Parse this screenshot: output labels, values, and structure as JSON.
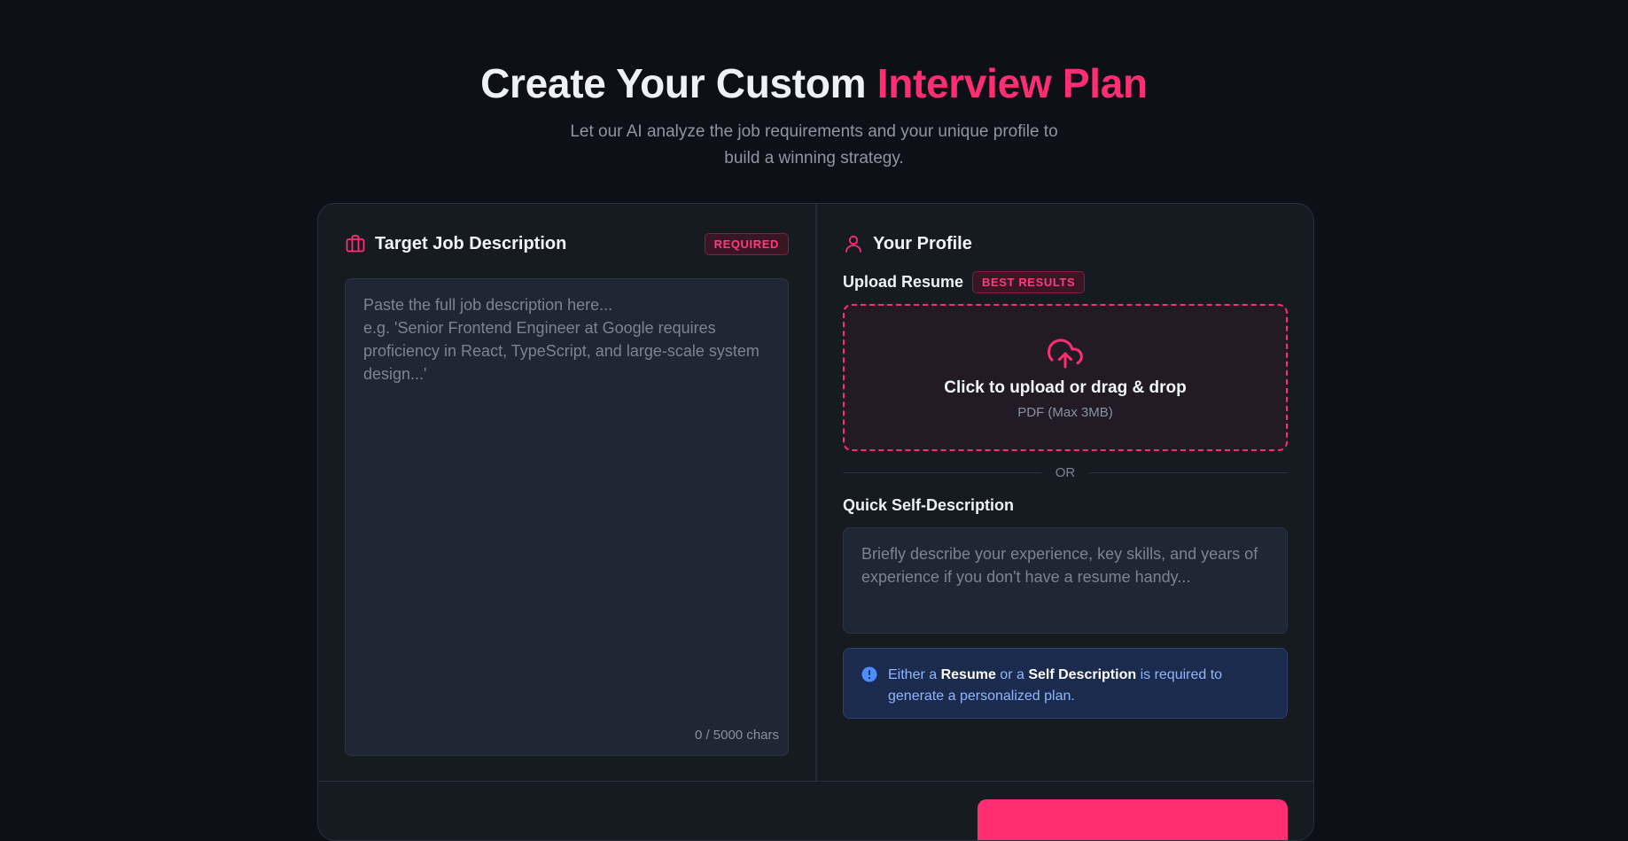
{
  "hero": {
    "title_main": "Create Your Custom ",
    "title_accent": "Interview Plan",
    "subtitle": "Let our AI analyze the job requirements and your unique profile to build a winning strategy."
  },
  "job": {
    "title": "Target Job Description",
    "badge": "REQUIRED",
    "placeholder": "Paste the full job description here...\ne.g. 'Senior Frontend Engineer at Google requires proficiency in React, TypeScript, and large-scale system design...'",
    "counter": "0 / 5000 chars",
    "icon": "briefcase-icon"
  },
  "profile": {
    "title": "Your Profile",
    "icon": "user-icon",
    "upload_label": "Upload Resume",
    "upload_badge": "BEST RESULTS",
    "dropzone_main": "Click to upload or drag & drop",
    "dropzone_hint": "PDF (Max 3MB)",
    "dropzone_icon": "cloud-upload-icon",
    "or_text": "OR",
    "self_label": "Quick Self-Description",
    "self_placeholder": "Briefly describe your experience, key skills, and years of experience if you don't have a resume handy...",
    "info": {
      "icon": "info-icon",
      "part1": "Either a ",
      "bold1": "Resume",
      "part2": " or a ",
      "bold2": "Self Description",
      "part3": " is required to generate a personalized plan."
    }
  },
  "colors": {
    "accent": "#ff2d72",
    "background": "#0d1117",
    "card": "#161b22",
    "info_bg": "#1b2b4d",
    "info_text": "#8fb6ff"
  }
}
